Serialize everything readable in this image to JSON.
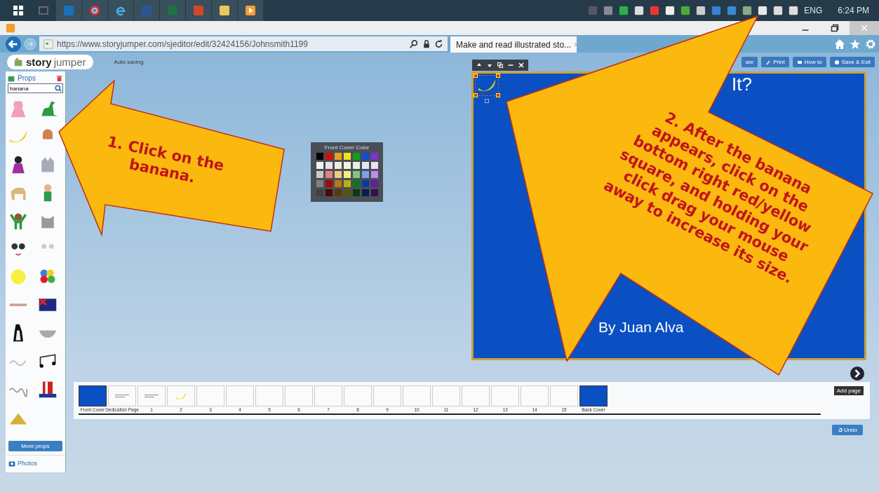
{
  "taskbar": {
    "language": "ENG",
    "clock": "6:24 PM"
  },
  "browser": {
    "url": "https://www.storyjumper.com/sjeditor/edit/32424156/Johnsmith1199",
    "tab_title": "Make and read illustrated sto...",
    "tab_close": "×"
  },
  "header": {
    "logo_bold": "story",
    "logo_light": "jumper",
    "status": "Auto saving.",
    "buttons": [
      {
        "label": "are",
        "kind": "share"
      },
      {
        "label": "Print",
        "kind": "print"
      },
      {
        "label": "How to",
        "kind": "howto"
      },
      {
        "label": "Save & Exit",
        "kind": "save"
      }
    ]
  },
  "props_panel": {
    "title": "Props",
    "search": {
      "value": "banana"
    },
    "more_button": "More props",
    "photos_label": "Photos"
  },
  "color_picker": {
    "title": "Front Cover Color",
    "swatches": [
      {
        "color": "#000000"
      },
      {
        "color": "#d01010"
      },
      {
        "color": "#e8a020"
      },
      {
        "color": "#f0e020"
      },
      {
        "color": "#10a020"
      },
      {
        "color": "#1050d0"
      },
      {
        "color": "#8030d0"
      },
      {
        "color": "#f4f4f4"
      },
      {
        "color": "#f0e0e0"
      },
      {
        "color": "#f4ecd8"
      },
      {
        "color": "#f6f4d8"
      },
      {
        "color": "#e4f0e4"
      },
      {
        "color": "#e0e8f4"
      },
      {
        "color": "#ece0f4"
      },
      {
        "color": "#c8c8c8"
      },
      {
        "color": "#e88080"
      },
      {
        "color": "#f0cc80"
      },
      {
        "color": "#f0f080"
      },
      {
        "color": "#80c880"
      },
      {
        "color": "#80a0e8"
      },
      {
        "color": "#b890e8"
      },
      {
        "color": "#808080"
      },
      {
        "color": "#a00c0c"
      },
      {
        "color": "#b87818"
      },
      {
        "color": "#b8b010"
      },
      {
        "color": "#0c7818"
      },
      {
        "color": "#0c3ca0"
      },
      {
        "color": "#6020a0"
      },
      {
        "color": "#404040"
      },
      {
        "color": "#500808"
      },
      {
        "color": "#583c0c"
      },
      {
        "color": "#585408"
      },
      {
        "color": "#083c0c"
      },
      {
        "color": "#081e50"
      },
      {
        "color": "#301050"
      }
    ]
  },
  "book_page": {
    "title": "It?",
    "author": "By Juan Alva"
  },
  "page_strip": {
    "pages": [
      {
        "label": "Front Cover",
        "kind": "cover"
      },
      {
        "label": "Dedication Page",
        "kind": "text"
      },
      {
        "label": "1",
        "kind": "text"
      },
      {
        "label": "2",
        "kind": "banana"
      },
      {
        "label": "3",
        "kind": "blank"
      },
      {
        "label": "4",
        "kind": "blank"
      },
      {
        "label": "5",
        "kind": "blank"
      },
      {
        "label": "6",
        "kind": "blank"
      },
      {
        "label": "7",
        "kind": "blank"
      },
      {
        "label": "8",
        "kind": "blank"
      },
      {
        "label": "9",
        "kind": "blank"
      },
      {
        "label": "10",
        "kind": "blank"
      },
      {
        "label": "11",
        "kind": "blank"
      },
      {
        "label": "12",
        "kind": "blank"
      },
      {
        "label": "13",
        "kind": "blank"
      },
      {
        "label": "14",
        "kind": "blank"
      },
      {
        "label": "15",
        "kind": "blank"
      },
      {
        "label": "Back Cover",
        "kind": "cover"
      }
    ],
    "add_button": "Add page",
    "undo_button": "Undo"
  },
  "callouts": [
    {
      "lines": [
        "1. Click on the",
        "banana."
      ]
    },
    {
      "lines": [
        "2. After the banana",
        "appears, click on the",
        "bottom right red/yellow",
        "square, and holding your",
        "click drag your mouse",
        "away to increase its size."
      ]
    }
  ]
}
